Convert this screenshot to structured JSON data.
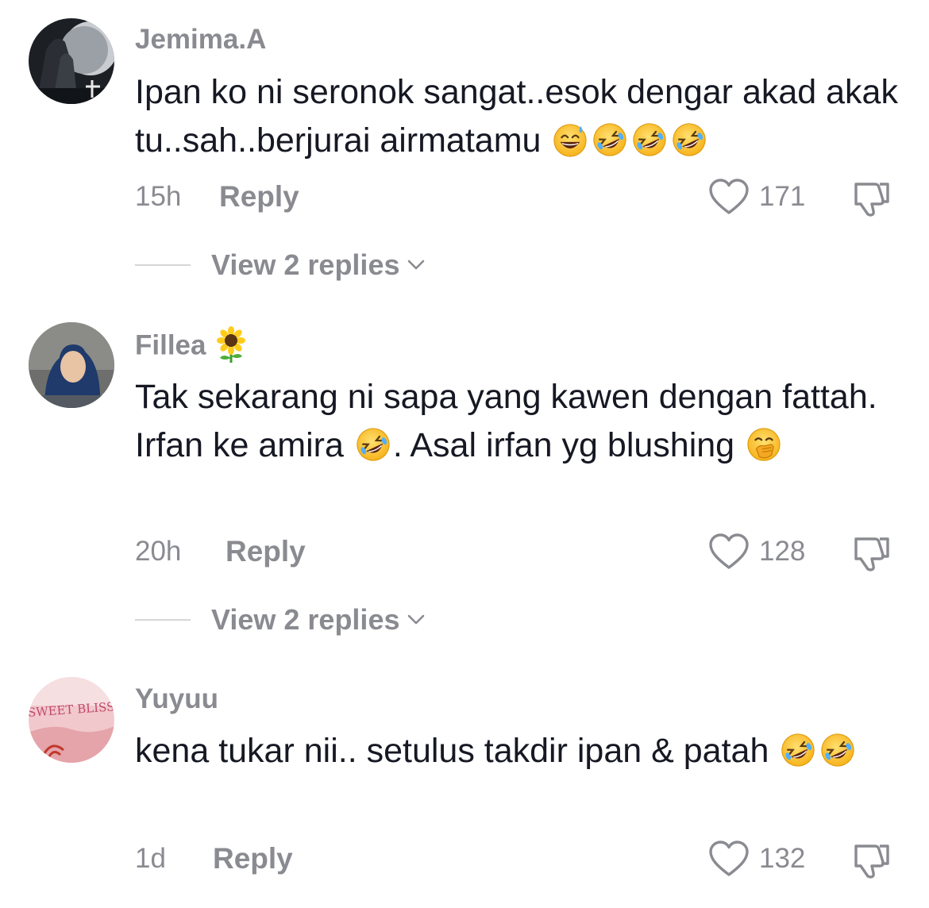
{
  "comments": [
    {
      "username": "Jemima.A",
      "text_parts": [
        "Ipan ko ni seronok sangat..esok dengar akad akak tu..sah..berjurai airmatamu "
      ],
      "emojis": [
        "grinning-sweat",
        "rofl",
        "rofl",
        "rofl"
      ],
      "time": "15h",
      "reply_label": "Reply",
      "likes": "171",
      "view_replies": "View 2 replies"
    },
    {
      "username": "Fillea",
      "username_emoji": "sunflower",
      "text_a": "Tak sekarang ni sapa yang kawen dengan fattah. Irfan ke amira ",
      "text_b": ". Asal irfan yg blushing ",
      "emojis": [
        "rofl",
        "hand-over-mouth"
      ],
      "time": "20h",
      "reply_label": "Reply",
      "likes": "128",
      "view_replies": "View 2 replies"
    },
    {
      "username": "Yuyuu",
      "text": "kena tukar nii.. setulus takdir ipan & patah ",
      "emojis": [
        "rofl",
        "rofl"
      ],
      "avatar_text": "SWEET BLISS",
      "time": "1d",
      "reply_label": "Reply",
      "likes": "132"
    }
  ],
  "colors": {
    "text": "#161823",
    "secondary": "#8a8b91",
    "divider": "#d6d6d8"
  }
}
